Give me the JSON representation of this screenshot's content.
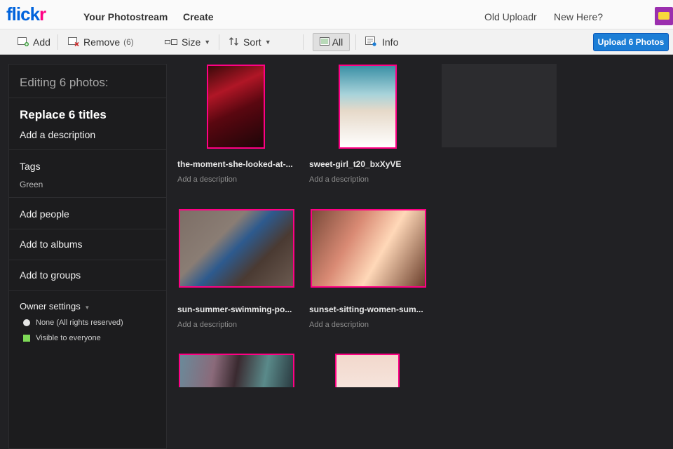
{
  "topnav": {
    "logo_blue": "flick",
    "logo_pink": "r",
    "links": [
      "Your Photostream",
      "Create"
    ],
    "right_links": [
      "Old Uploadr",
      "New Here?"
    ]
  },
  "toolbar": {
    "add": "Add",
    "remove": "Remove",
    "remove_count": "(6)",
    "size": "Size",
    "sort": "Sort",
    "all": "All",
    "info": "Info",
    "upload": "Upload 6 Photos"
  },
  "sidebar": {
    "heading": "Editing 6 photos:",
    "replace_titles": "Replace 6 titles",
    "add_description": "Add a description",
    "tags_label": "Tags",
    "tag_value": "Green",
    "add_people": "Add people",
    "add_albums": "Add to albums",
    "add_groups": "Add to groups",
    "owner_settings": "Owner settings",
    "rights": "None (All rights reserved)",
    "visibility": "Visible to everyone"
  },
  "photos": [
    {
      "title": "the-moment-she-looked-at-...",
      "desc": "Add a description"
    },
    {
      "title": "sweet-girl_t20_bxXyVE",
      "desc": "Add a description"
    },
    {
      "title": "sun-summer-swimming-po...",
      "desc": "Add a description"
    },
    {
      "title": "sunset-sitting-women-sum...",
      "desc": "Add a description"
    },
    {
      "title": "",
      "desc": ""
    },
    {
      "title": "",
      "desc": ""
    }
  ],
  "colors": {
    "brand_blue": "#0063dc",
    "brand_pink": "#ff0084",
    "upload_button": "#1c7ed6",
    "background": "#212124"
  }
}
